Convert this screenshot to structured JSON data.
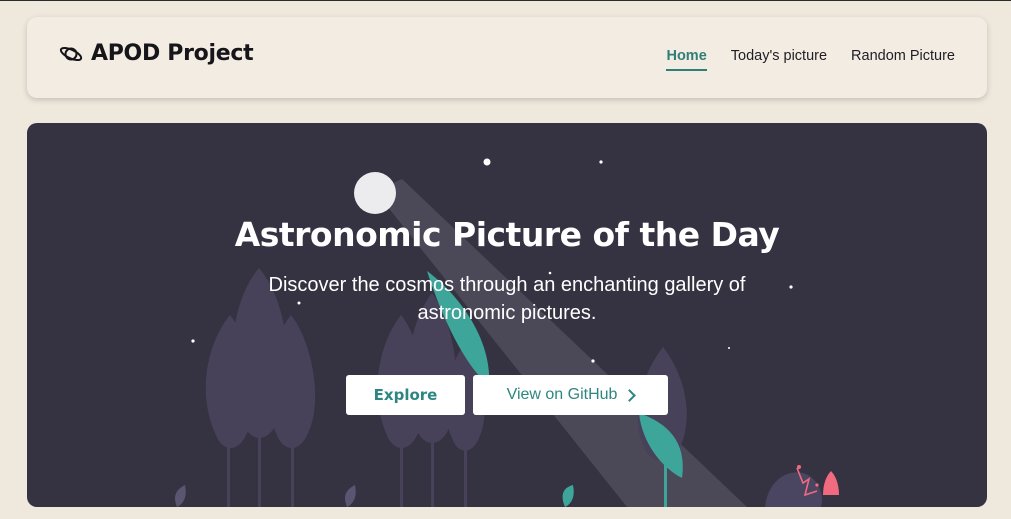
{
  "navbar": {
    "brand": "APOD Project",
    "brand_icon": "planet-icon",
    "links": [
      {
        "label": "Home",
        "active": true
      },
      {
        "label": "Today's picture",
        "active": false
      },
      {
        "label": "Random Picture",
        "active": false
      }
    ]
  },
  "hero": {
    "title": "Astronomic Picture of the Day",
    "subtitle": "Discover the cosmos through an enchanting gallery of astronomic pictures.",
    "explore_label": "Explore",
    "github_label": "View on GitHub",
    "github_icon": "chevron-right-icon"
  },
  "colors": {
    "page_bg": "#efe8dd",
    "navbar_bg": "#f3ece2",
    "hero_bg": "#353241",
    "accent": "#2f7f79",
    "teal_plant": "#3ea59a",
    "tree": "#4a4560",
    "rocket": "#f06a80"
  }
}
